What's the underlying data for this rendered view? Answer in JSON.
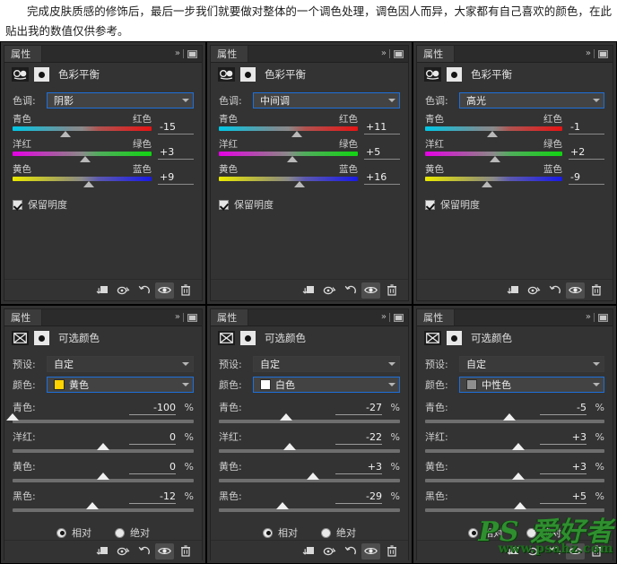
{
  "intro": {
    "text": "完成皮肤质感的修饰后，最后一步我们就要做对整体的一个调色处理，调色因人而异，大家都有自己喜欢的颜色，在此贴出我的数值仅供参考。"
  },
  "common": {
    "panel_tab_label": "属性",
    "expand_icon": "chevron-double-right-icon",
    "menu_icon": "panel-menu-icon",
    "toolbar": {
      "clip_label": "clip-to-layer-icon",
      "preview_prev_label": "view-previous-state-icon",
      "reset_label": "reset-icon",
      "visibility_label": "toggle-visibility-icon",
      "delete_label": "delete-adjustment-icon"
    },
    "colors": {
      "panel_bg": "#333333",
      "titlebar_bg": "#2b2b2b",
      "tab_bg": "#3b3b3b",
      "select_border_focus": "#1e6fd9",
      "text": "#d4d4d4"
    }
  },
  "panels": [
    {
      "id": "color-balance-shadows",
      "type": "color_balance",
      "adjustment_title": "色彩平衡",
      "adjustment_icon": "color-balance-icon",
      "mask_icon": "layer-mask-icon",
      "tone_label": "色调:",
      "tone_value": "阴影",
      "sliders": [
        {
          "left_label": "青色",
          "right_label": "红色",
          "value": "-15",
          "pos": 38,
          "track": "cyan-red"
        },
        {
          "left_label": "洋红",
          "right_label": "绿色",
          "value": "+3",
          "pos": 52,
          "track": "magenta-green"
        },
        {
          "left_label": "黄色",
          "right_label": "蓝色",
          "value": "+9",
          "pos": 55,
          "track": "yellow-blue"
        }
      ],
      "preserve_luminosity_label": "保留明度",
      "preserve_luminosity_checked": true
    },
    {
      "id": "color-balance-midtones",
      "type": "color_balance",
      "adjustment_title": "色彩平衡",
      "adjustment_icon": "color-balance-icon",
      "mask_icon": "layer-mask-icon",
      "tone_label": "色调:",
      "tone_value": "中间调",
      "sliders": [
        {
          "left_label": "青色",
          "right_label": "红色",
          "value": "+11",
          "pos": 56,
          "track": "cyan-red"
        },
        {
          "left_label": "洋红",
          "right_label": "绿色",
          "value": "+5",
          "pos": 53,
          "track": "magenta-green"
        },
        {
          "left_label": "黄色",
          "right_label": "蓝色",
          "value": "+16",
          "pos": 58,
          "track": "yellow-blue"
        }
      ],
      "preserve_luminosity_label": "保留明度",
      "preserve_luminosity_checked": true
    },
    {
      "id": "color-balance-highlights",
      "type": "color_balance",
      "adjustment_title": "色彩平衡",
      "adjustment_icon": "color-balance-icon",
      "mask_icon": "layer-mask-icon",
      "tone_label": "色调:",
      "tone_value": "高光",
      "sliders": [
        {
          "left_label": "青色",
          "right_label": "红色",
          "value": "-1",
          "pos": 49,
          "track": "cyan-red"
        },
        {
          "left_label": "洋红",
          "right_label": "绿色",
          "value": "+2",
          "pos": 51,
          "track": "magenta-green"
        },
        {
          "left_label": "黄色",
          "right_label": "蓝色",
          "value": "-9",
          "pos": 45,
          "track": "yellow-blue"
        }
      ],
      "preserve_luminosity_label": "保留明度",
      "preserve_luminosity_checked": true
    },
    {
      "id": "selective-color-yellow",
      "type": "selective_color",
      "adjustment_title": "可选颜色",
      "adjustment_icon": "selective-color-icon",
      "mask_icon": "layer-mask-icon",
      "preset_label": "预设:",
      "preset_value": "自定",
      "color_label": "颜色:",
      "color_value": "黄色",
      "color_swatch": "#ffd400",
      "sliders": [
        {
          "name": "青色:",
          "value": "-100",
          "unit": "%",
          "pos": 0
        },
        {
          "name": "洋红:",
          "value": "0",
          "unit": "%",
          "pos": 50
        },
        {
          "name": "黄色:",
          "value": "0",
          "unit": "%",
          "pos": 50
        },
        {
          "name": "黑色:",
          "value": "-12",
          "unit": "%",
          "pos": 44
        }
      ],
      "method": {
        "relative_label": "相对",
        "absolute_label": "绝对",
        "selected": "relative"
      }
    },
    {
      "id": "selective-color-white",
      "type": "selective_color",
      "adjustment_title": "可选颜色",
      "adjustment_icon": "selective-color-icon",
      "mask_icon": "layer-mask-icon",
      "preset_label": "预设:",
      "preset_value": "自定",
      "color_label": "颜色:",
      "color_value": "白色",
      "color_swatch": "#ffffff",
      "sliders": [
        {
          "name": "青色:",
          "value": "-27",
          "unit": "%",
          "pos": 37
        },
        {
          "name": "洋红:",
          "value": "-22",
          "unit": "%",
          "pos": 39
        },
        {
          "name": "黄色:",
          "value": "+3",
          "unit": "%",
          "pos": 52
        },
        {
          "name": "黑色:",
          "value": "-29",
          "unit": "%",
          "pos": 35
        }
      ],
      "method": {
        "relative_label": "相对",
        "absolute_label": "绝对",
        "selected": "relative"
      }
    },
    {
      "id": "selective-color-neutrals",
      "type": "selective_color",
      "adjustment_title": "可选颜色",
      "adjustment_icon": "selective-color-icon",
      "mask_icon": "layer-mask-icon",
      "preset_label": "预设:",
      "preset_value": "自定",
      "color_label": "颜色:",
      "color_value": "中性色",
      "color_swatch": "#8f8f8f",
      "sliders": [
        {
          "name": "青色:",
          "value": "-5",
          "unit": "%",
          "pos": 47
        },
        {
          "name": "洋红:",
          "value": "+3",
          "unit": "%",
          "pos": 52
        },
        {
          "name": "黄色:",
          "value": "+3",
          "unit": "%",
          "pos": 52
        },
        {
          "name": "黑色:",
          "value": "+5",
          "unit": "%",
          "pos": 53
        }
      ],
      "method": {
        "relative_label": "相对",
        "absolute_label": "绝对",
        "selected": "relative"
      }
    }
  ],
  "watermark": {
    "brand": "PS 爱好者",
    "url": "www.psahz.com"
  }
}
